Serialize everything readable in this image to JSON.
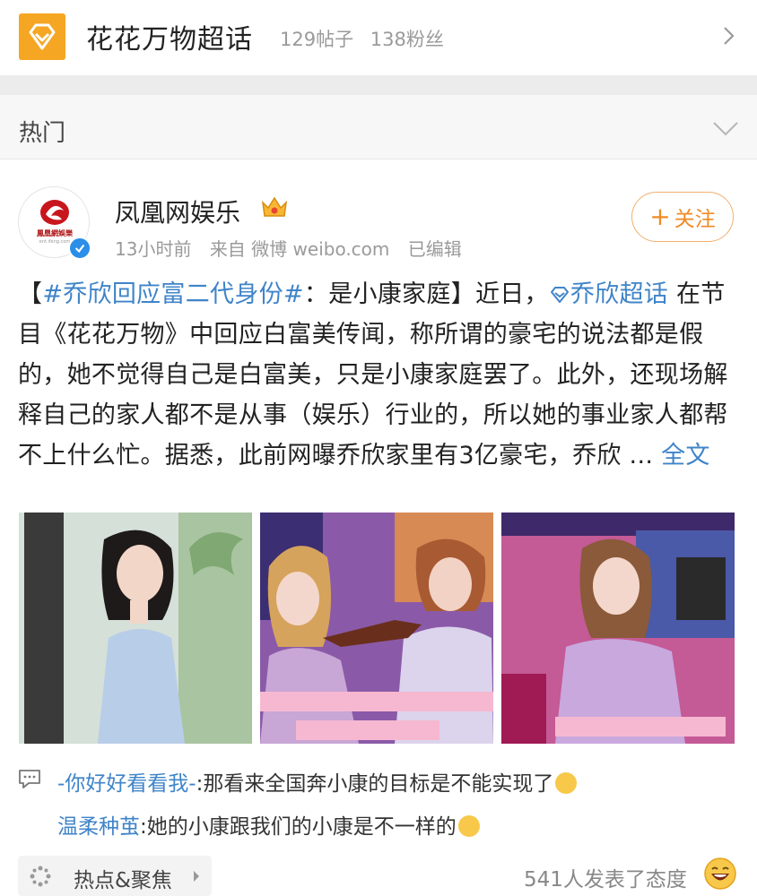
{
  "header": {
    "title": "花花万物超话",
    "posts": "129帖子",
    "fans": "138粉丝"
  },
  "section": {
    "label": "热门"
  },
  "post": {
    "author": "凤凰网娱乐",
    "avatar_text": "鳳凰網娛樂",
    "avatar_subtext": "ent.ifeng.com",
    "time": "13小时前",
    "source": "来自 微博 weibo.com",
    "edited": "已编辑",
    "follow_label": "关注",
    "text": {
      "bracket_open": "【",
      "hashtag": "#乔欣回应富二代身份#",
      "after_hashtag": "：是小康家庭】近日，",
      "super_topic": "乔欣超话",
      "body": " 在节目《花花万物》中回应白富美传闻，称所谓的豪宅的说法都是假的，她不觉得自己是白富美，只是小康家庭罢了。此外，还现场解释自己的家人都不是从事（娱乐）行业的，所以她的事业家人都帮不上什么忙。据悉，此前网曝乔欣家里有3亿豪宅，乔欣 ...",
      "full_text": "全文"
    }
  },
  "comments": [
    {
      "user": "-你好好看看我-",
      "text": ":那看来全国奔小康的目标是不能实现了"
    },
    {
      "user": "温柔种茧",
      "text": ":她的小康跟我们的小康是不一样的"
    }
  ],
  "footer": {
    "hot_label": "热点&聚焦",
    "reactions": "541人发表了态度"
  },
  "colors": {
    "brand_orange": "#f5a623",
    "link_blue": "#3f84c9",
    "follow_orange": "#f08a24"
  }
}
